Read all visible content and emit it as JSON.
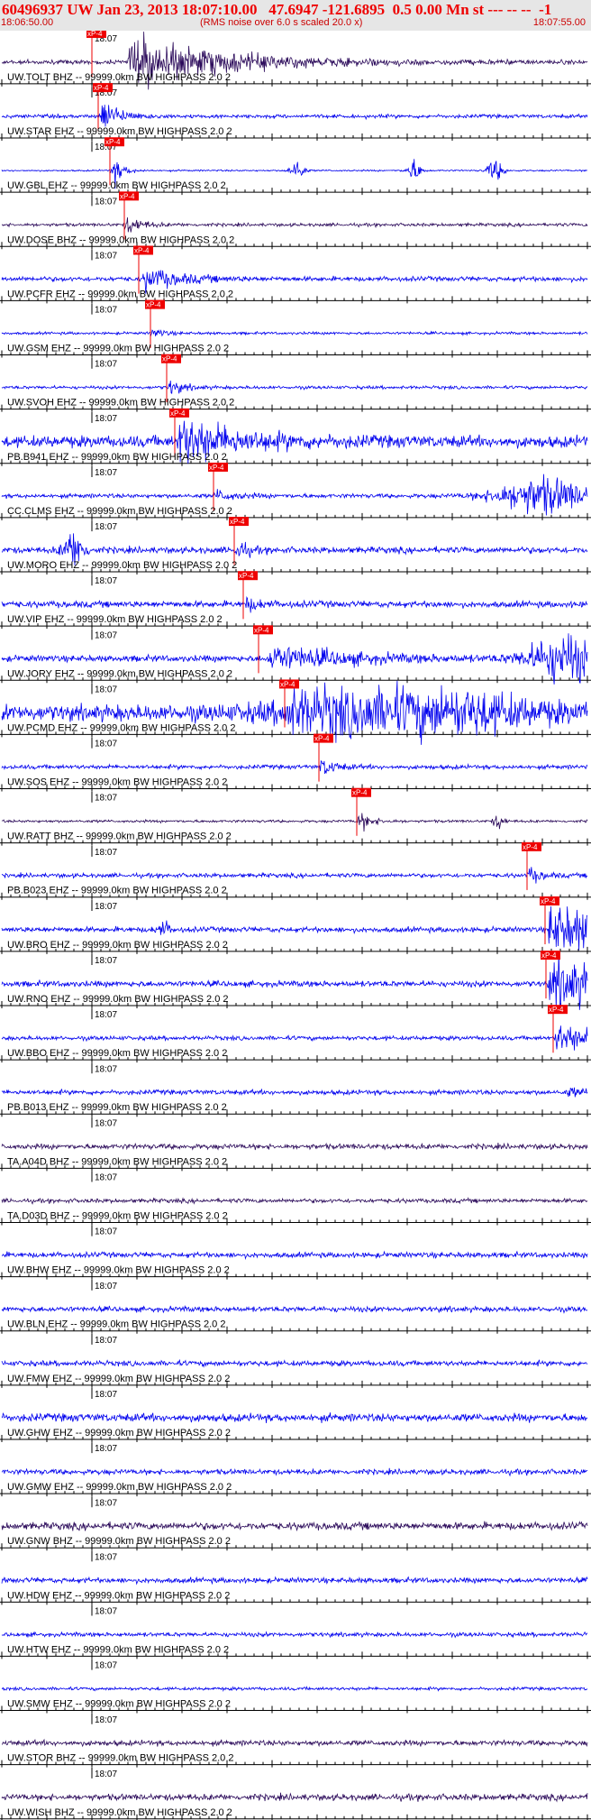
{
  "header": {
    "title": "60496937 UW Jan 23, 2013 18:07:10.00   47.6947 -121.6895  0.5 0.00 Mn st --- -- --  -1",
    "time_start": "18:06:50.00",
    "rms_note": "(RMS noise over 6.0 s scaled 20.0 x)",
    "time_end": "18:07:55.00"
  },
  "chart_data": {
    "type": "line",
    "title": "60496937 UW Jan 23, 2013 18:07:10.00   47.6947 -121.6895  0.5 0.00 Mn st --- -- --  -1",
    "xlabel": "",
    "ylabel": "",
    "xlim": [
      "18:06:50.00",
      "18:07:55.00"
    ],
    "minute_label": "18:07",
    "pick_label": "xP-4",
    "colors": {
      "blue": "#0000ee",
      "dark": "#2b0a5a",
      "pick": "#ee0000"
    },
    "series": [
      {
        "label": "UW.TOLT BHZ -- 99999.0km BW  HIGHPASS  2.0  2",
        "color": "dark",
        "pick_s": 10,
        "arrival_s": 14,
        "amp": 1.0,
        "decay": 10,
        "noise": 0.08,
        "bursts": []
      },
      {
        "label": "UW.STAR EHZ -- 99999.0km BW  HIGHPASS  2.0  2",
        "color": "blue",
        "pick_s": 10.7,
        "arrival_s": 10.7,
        "amp": 0.85,
        "decay": 1.8,
        "noise": 0.07,
        "bursts": []
      },
      {
        "label": "UW.GBL  EHZ -- 99999.0km BW  HIGHPASS  2.0  2",
        "color": "blue",
        "pick_s": 12,
        "arrival_s": 12,
        "amp": 0.85,
        "decay": 1.0,
        "noise": 0.03,
        "bursts": [
          [
            32.8,
            0.8,
            0.4
          ],
          [
            45.8,
            0.8,
            0.4
          ],
          [
            54.8,
            0.9,
            0.4
          ]
        ]
      },
      {
        "label": "UW.DOSE BHZ -- 99999.0km BW  HIGHPASS  2.0  2",
        "color": "dark",
        "pick_s": 13.6,
        "arrival_s": 13.6,
        "amp": 0.45,
        "decay": 1.5,
        "noise": 0.06,
        "bursts": []
      },
      {
        "label": "UW.PCFR EHZ -- 99999.0km BW  HIGHPASS  2.0  2",
        "color": "blue",
        "pick_s": 15.2,
        "arrival_s": 15.6,
        "amp": 0.5,
        "decay": 3.5,
        "noise": 0.09,
        "bursts": []
      },
      {
        "label": "UW.GSM  EHZ -- 99999.0km BW  HIGHPASS  2.0  2",
        "color": "blue",
        "pick_s": 16.5,
        "arrival_s": 16.5,
        "amp": 0.3,
        "decay": 1.0,
        "noise": 0.05,
        "bursts": []
      },
      {
        "label": "UW.SVOH EHZ -- 99999.0km BW  HIGHPASS  2.0  2",
        "color": "blue",
        "pick_s": 18.3,
        "arrival_s": 18.3,
        "amp": 0.35,
        "decay": 1.5,
        "noise": 0.06,
        "bursts": []
      },
      {
        "label": "PB.B941 EHZ -- 99999.0km BW  HIGHPASS  2.0  2",
        "color": "blue",
        "pick_s": 19.2,
        "arrival_s": 19.4,
        "amp": 0.95,
        "decay": 6,
        "noise": 0.22,
        "bursts": []
      },
      {
        "label": "CC.CLMS EHZ -- 99999.0km BW  HIGHPASS  2.0  2",
        "color": "blue",
        "pick_s": 23.5,
        "arrival_s": 23.5,
        "amp": 0.25,
        "decay": 2,
        "noise": 0.08,
        "bursts": [
          [
            60,
            5,
            0.7
          ]
        ]
      },
      {
        "label": "UW.MORO EHZ -- 99999.0km BW  HIGHPASS  2.0  2",
        "color": "blue",
        "pick_s": 25.8,
        "arrival_s": 25.8,
        "amp": 0.65,
        "decay": 0.9,
        "noise": 0.12,
        "bursts": [
          [
            8,
            1.2,
            0.7
          ]
        ]
      },
      {
        "label": "UW.VIP  EHZ -- 99999.0km BW  HIGHPASS  2.0  2",
        "color": "blue",
        "pick_s": 26.8,
        "arrival_s": 26.8,
        "amp": 0.3,
        "decay": 1.5,
        "noise": 0.12,
        "bursts": []
      },
      {
        "label": "UW.JORY EHZ -- 99999.0km BW  HIGHPASS  2.0  2",
        "color": "blue",
        "pick_s": 28.5,
        "arrival_s": 29.5,
        "amp": 0.5,
        "decay": 8,
        "noise": 0.12,
        "bursts": [
          [
            62.5,
            4,
            0.9
          ]
        ]
      },
      {
        "label": "UW.PCMD EHZ -- 99999.0km BW  HIGHPASS  2.0  2",
        "color": "blue",
        "pick_s": 31.4,
        "arrival_s": 31.4,
        "amp": 0.6,
        "decay": 14,
        "noise": 0.3,
        "bursts": [
          [
            45,
            12,
            0.8
          ]
        ]
      },
      {
        "label": "UW.SOS  EHZ -- 99999.0km BW  HIGHPASS  2.0  2",
        "color": "blue",
        "pick_s": 35.2,
        "arrival_s": 35.2,
        "amp": 0.45,
        "decay": 1.4,
        "noise": 0.08,
        "bursts": []
      },
      {
        "label": "UW.RATT BHZ -- 99999.0km BW  HIGHPASS  2.0  2",
        "color": "dark",
        "pick_s": 39.4,
        "arrival_s": 39.4,
        "amp": 0.5,
        "decay": 1.2,
        "noise": 0.05,
        "bursts": [
          [
            55.2,
            0.6,
            0.3
          ]
        ]
      },
      {
        "label": "PB.B023 EHZ -- 99999.0km BW  HIGHPASS  2.0  2",
        "color": "blue",
        "pick_s": 58.3,
        "arrival_s": 58.3,
        "amp": 0.4,
        "decay": 1.2,
        "noise": 0.08,
        "bursts": []
      },
      {
        "label": "UW.BRO  EHZ -- 99999.0km BW  HIGHPASS  2.0  2",
        "color": "blue",
        "pick_s": 60.3,
        "arrival_s": 60.5,
        "amp": 1.0,
        "decay": 10,
        "noise": 0.1,
        "bursts": [
          [
            18,
            0.8,
            0.25
          ]
        ]
      },
      {
        "label": "UW.RNO  EHZ -- 99999.0km BW  HIGHPASS  2.0  2",
        "color": "blue",
        "pick_s": 60.4,
        "arrival_s": 60.6,
        "amp": 1.0,
        "decay": 10,
        "noise": 0.11,
        "bursts": []
      },
      {
        "label": "UW.BBO  EHZ -- 99999.0km BW  HIGHPASS  2.0  2",
        "color": "blue",
        "pick_s": 61.2,
        "arrival_s": 61.3,
        "amp": 0.6,
        "decay": 5,
        "noise": 0.08,
        "bursts": []
      },
      {
        "label": "PB.B013 EHZ -- 99999.0km BW  HIGHPASS  2.0  2",
        "color": "blue",
        "pick_s": null,
        "arrival_s": 62.5,
        "amp": 0.15,
        "decay": 3,
        "noise": 0.09,
        "bursts": []
      },
      {
        "label": "TA.A04D BHZ -- 99999.0km BW  HIGHPASS  2.0  2",
        "color": "dark",
        "pick_s": null,
        "arrival_s": null,
        "amp": 0,
        "decay": 1,
        "noise": 0.1,
        "bursts": []
      },
      {
        "label": "TA.D03D BHZ -- 99999.0km BW  HIGHPASS  2.0  2",
        "color": "dark",
        "pick_s": null,
        "arrival_s": null,
        "amp": 0,
        "decay": 1,
        "noise": 0.08,
        "bursts": []
      },
      {
        "label": "UW.BHW  EHZ -- 99999.0km BW  HIGHPASS  2.0  2",
        "color": "blue",
        "pick_s": null,
        "arrival_s": null,
        "amp": 0,
        "decay": 1,
        "noise": 0.1,
        "bursts": []
      },
      {
        "label": "UW.BLN  EHZ -- 99999.0km BW  HIGHPASS  2.0  2",
        "color": "blue",
        "pick_s": null,
        "arrival_s": null,
        "amp": 0,
        "decay": 1,
        "noise": 0.1,
        "bursts": []
      },
      {
        "label": "UW.FMW  EHZ -- 99999.0km BW  HIGHPASS  2.0  2",
        "color": "blue",
        "pick_s": null,
        "arrival_s": null,
        "amp": 0,
        "decay": 1,
        "noise": 0.1,
        "bursts": []
      },
      {
        "label": "UW.GHW  EHZ -- 99999.0km BW  HIGHPASS  2.0  2",
        "color": "blue",
        "pick_s": null,
        "arrival_s": null,
        "amp": 0,
        "decay": 1,
        "noise": 0.15,
        "bursts": []
      },
      {
        "label": "UW.GMW  EHZ -- 99999.0km BW  HIGHPASS  2.0  2",
        "color": "blue",
        "pick_s": null,
        "arrival_s": null,
        "amp": 0,
        "decay": 1,
        "noise": 0.1,
        "bursts": []
      },
      {
        "label": "UW.GNW  BHZ -- 99999.0km BW  HIGHPASS  2.0  2",
        "color": "dark",
        "pick_s": null,
        "arrival_s": null,
        "amp": 0,
        "decay": 1,
        "noise": 0.14,
        "bursts": []
      },
      {
        "label": "UW.HDW  EHZ -- 99999.0km BW  HIGHPASS  2.0  2",
        "color": "blue",
        "pick_s": null,
        "arrival_s": null,
        "amp": 0,
        "decay": 1,
        "noise": 0.1,
        "bursts": []
      },
      {
        "label": "UW.HTW  EHZ -- 99999.0km BW  HIGHPASS  2.0  2",
        "color": "blue",
        "pick_s": null,
        "arrival_s": null,
        "amp": 0,
        "decay": 1,
        "noise": 0.08,
        "bursts": []
      },
      {
        "label": "UW.SMW  EHZ -- 99999.0km BW  HIGHPASS  2.0  2",
        "color": "blue",
        "pick_s": null,
        "arrival_s": null,
        "amp": 0,
        "decay": 1,
        "noise": 0.06,
        "bursts": []
      },
      {
        "label": "UW.STOR BHZ -- 99999.0km BW  HIGHPASS  2.0  2",
        "color": "dark",
        "pick_s": null,
        "arrival_s": null,
        "amp": 0,
        "decay": 1,
        "noise": 0.1,
        "bursts": []
      },
      {
        "label": "UW.WISH BHZ -- 99999.0km BW  HIGHPASS  2.0  2",
        "color": "dark",
        "pick_s": null,
        "arrival_s": null,
        "amp": 0,
        "decay": 1,
        "noise": 0.12,
        "bursts": []
      }
    ]
  }
}
